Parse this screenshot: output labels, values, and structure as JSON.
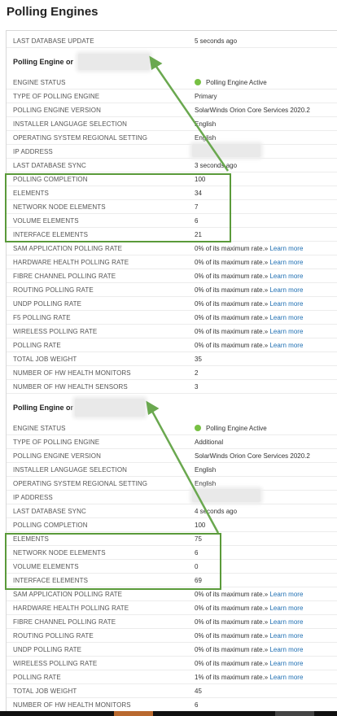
{
  "title": "Polling Engines",
  "top_row": {
    "label": "LAST DATABASE UPDATE",
    "value": "5 seconds ago"
  },
  "engine1": {
    "heading": "Polling Engine or",
    "rows": [
      {
        "label": "ENGINE STATUS",
        "value": "Polling Engine Active"
      },
      {
        "label": "TYPE OF POLLING ENGINE",
        "value": "Primary"
      },
      {
        "label": "POLLING ENGINE VERSION",
        "value": "SolarWinds Orion Core Services 2020.2"
      },
      {
        "label": "INSTALLER LANGUAGE SELECTION",
        "value": "English"
      },
      {
        "label": "OPERATING SYSTEM REGIONAL SETTING",
        "value": "English"
      },
      {
        "label": "IP ADDRESS",
        "value": ""
      },
      {
        "label": "LAST DATABASE SYNC",
        "value": "3 seconds ago"
      },
      {
        "label": "POLLING COMPLETION",
        "value": "100"
      },
      {
        "label": "ELEMENTS",
        "value": "34"
      },
      {
        "label": "NETWORK NODE ELEMENTS",
        "value": "7"
      },
      {
        "label": "VOLUME ELEMENTS",
        "value": "6"
      },
      {
        "label": "INTERFACE ELEMENTS",
        "value": "21"
      },
      {
        "label": "SAM APPLICATION POLLING RATE",
        "value": "0% of its maximum rate.»",
        "link": "Learn more"
      },
      {
        "label": "HARDWARE HEALTH POLLING RATE",
        "value": "0% of its maximum rate.»",
        "link": "Learn more"
      },
      {
        "label": "FIBRE CHANNEL POLLING RATE",
        "value": "0% of its maximum rate.»",
        "link": "Learn more"
      },
      {
        "label": "ROUTING POLLING RATE",
        "value": "0% of its maximum rate.»",
        "link": "Learn more"
      },
      {
        "label": "UNDP POLLING RATE",
        "value": "0% of its maximum rate.»",
        "link": "Learn more"
      },
      {
        "label": "F5 POLLING RATE",
        "value": "0% of its maximum rate.»",
        "link": "Learn more"
      },
      {
        "label": "WIRELESS POLLING RATE",
        "value": "0% of its maximum rate.»",
        "link": "Learn more"
      },
      {
        "label": "POLLING RATE",
        "value": "0% of its maximum rate.»",
        "link": "Learn more"
      },
      {
        "label": "TOTAL JOB WEIGHT",
        "value": "35"
      },
      {
        "label": "NUMBER OF HW HEALTH MONITORS",
        "value": "2"
      },
      {
        "label": "NUMBER OF HW HEALTH SENSORS",
        "value": "3"
      }
    ]
  },
  "engine2": {
    "heading": "Polling Engine or",
    "rows": [
      {
        "label": "ENGINE STATUS",
        "value": "Polling Engine Active"
      },
      {
        "label": "TYPE OF POLLING ENGINE",
        "value": "Additional"
      },
      {
        "label": "POLLING ENGINE VERSION",
        "value": "SolarWinds Orion Core Services 2020.2"
      },
      {
        "label": "INSTALLER LANGUAGE SELECTION",
        "value": "English"
      },
      {
        "label": "OPERATING SYSTEM REGIONAL SETTING",
        "value": "English"
      },
      {
        "label": "IP ADDRESS",
        "value": ""
      },
      {
        "label": "LAST DATABASE SYNC",
        "value": "4 seconds ago"
      },
      {
        "label": "POLLING COMPLETION",
        "value": "100"
      },
      {
        "label": "ELEMENTS",
        "value": "75"
      },
      {
        "label": "NETWORK NODE ELEMENTS",
        "value": "6"
      },
      {
        "label": "VOLUME ELEMENTS",
        "value": "0"
      },
      {
        "label": "INTERFACE ELEMENTS",
        "value": "69"
      },
      {
        "label": "SAM APPLICATION POLLING RATE",
        "value": "0% of its maximum rate.»",
        "link": "Learn more"
      },
      {
        "label": "HARDWARE HEALTH POLLING RATE",
        "value": "0% of its maximum rate.»",
        "link": "Learn more"
      },
      {
        "label": "FIBRE CHANNEL POLLING RATE",
        "value": "0% of its maximum rate.»",
        "link": "Learn more"
      },
      {
        "label": "ROUTING POLLING RATE",
        "value": "0% of its maximum rate.»",
        "link": "Learn more"
      },
      {
        "label": "UNDP POLLING RATE",
        "value": "0% of its maximum rate.»",
        "link": "Learn more"
      },
      {
        "label": "WIRELESS POLLING RATE",
        "value": "0% of its maximum rate.»",
        "link": "Learn more"
      },
      {
        "label": "POLLING RATE",
        "value": "1% of its maximum rate.»",
        "link": "Learn more"
      },
      {
        "label": "TOTAL JOB WEIGHT",
        "value": "45"
      },
      {
        "label": "NUMBER OF HW HEALTH MONITORS",
        "value": "6"
      }
    ]
  },
  "colors": {
    "highlight": "#5a9a3a",
    "status_dot": "#77c043",
    "link": "#1f6fb2"
  }
}
